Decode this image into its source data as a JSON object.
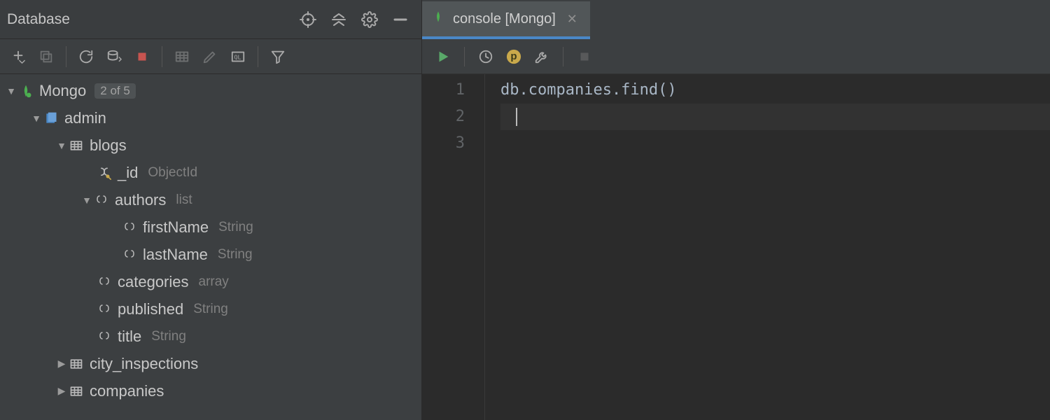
{
  "panel": {
    "title": "Database"
  },
  "tree": {
    "root": {
      "label": "Mongo",
      "badge": "2 of 5"
    },
    "db": {
      "label": "admin"
    },
    "coll_blogs": {
      "label": "blogs"
    },
    "fields": {
      "id": {
        "label": "_id",
        "type": "ObjectId"
      },
      "authors": {
        "label": "authors",
        "type": "list"
      },
      "firstName": {
        "label": "firstName",
        "type": "String"
      },
      "lastName": {
        "label": "lastName",
        "type": "String"
      },
      "categories": {
        "label": "categories",
        "type": "array"
      },
      "published": {
        "label": "published",
        "type": "String"
      },
      "title": {
        "label": "title",
        "type": "String"
      }
    },
    "coll_city": {
      "label": "city_inspections"
    },
    "coll_companies": {
      "label": "companies"
    }
  },
  "tab": {
    "label": "console [Mongo]"
  },
  "editor": {
    "lines": {
      "l1": "db.companies.find()",
      "l2": "",
      "l3": ""
    },
    "gutter": {
      "n1": "1",
      "n2": "2",
      "n3": "3"
    }
  },
  "p_badge": "p"
}
